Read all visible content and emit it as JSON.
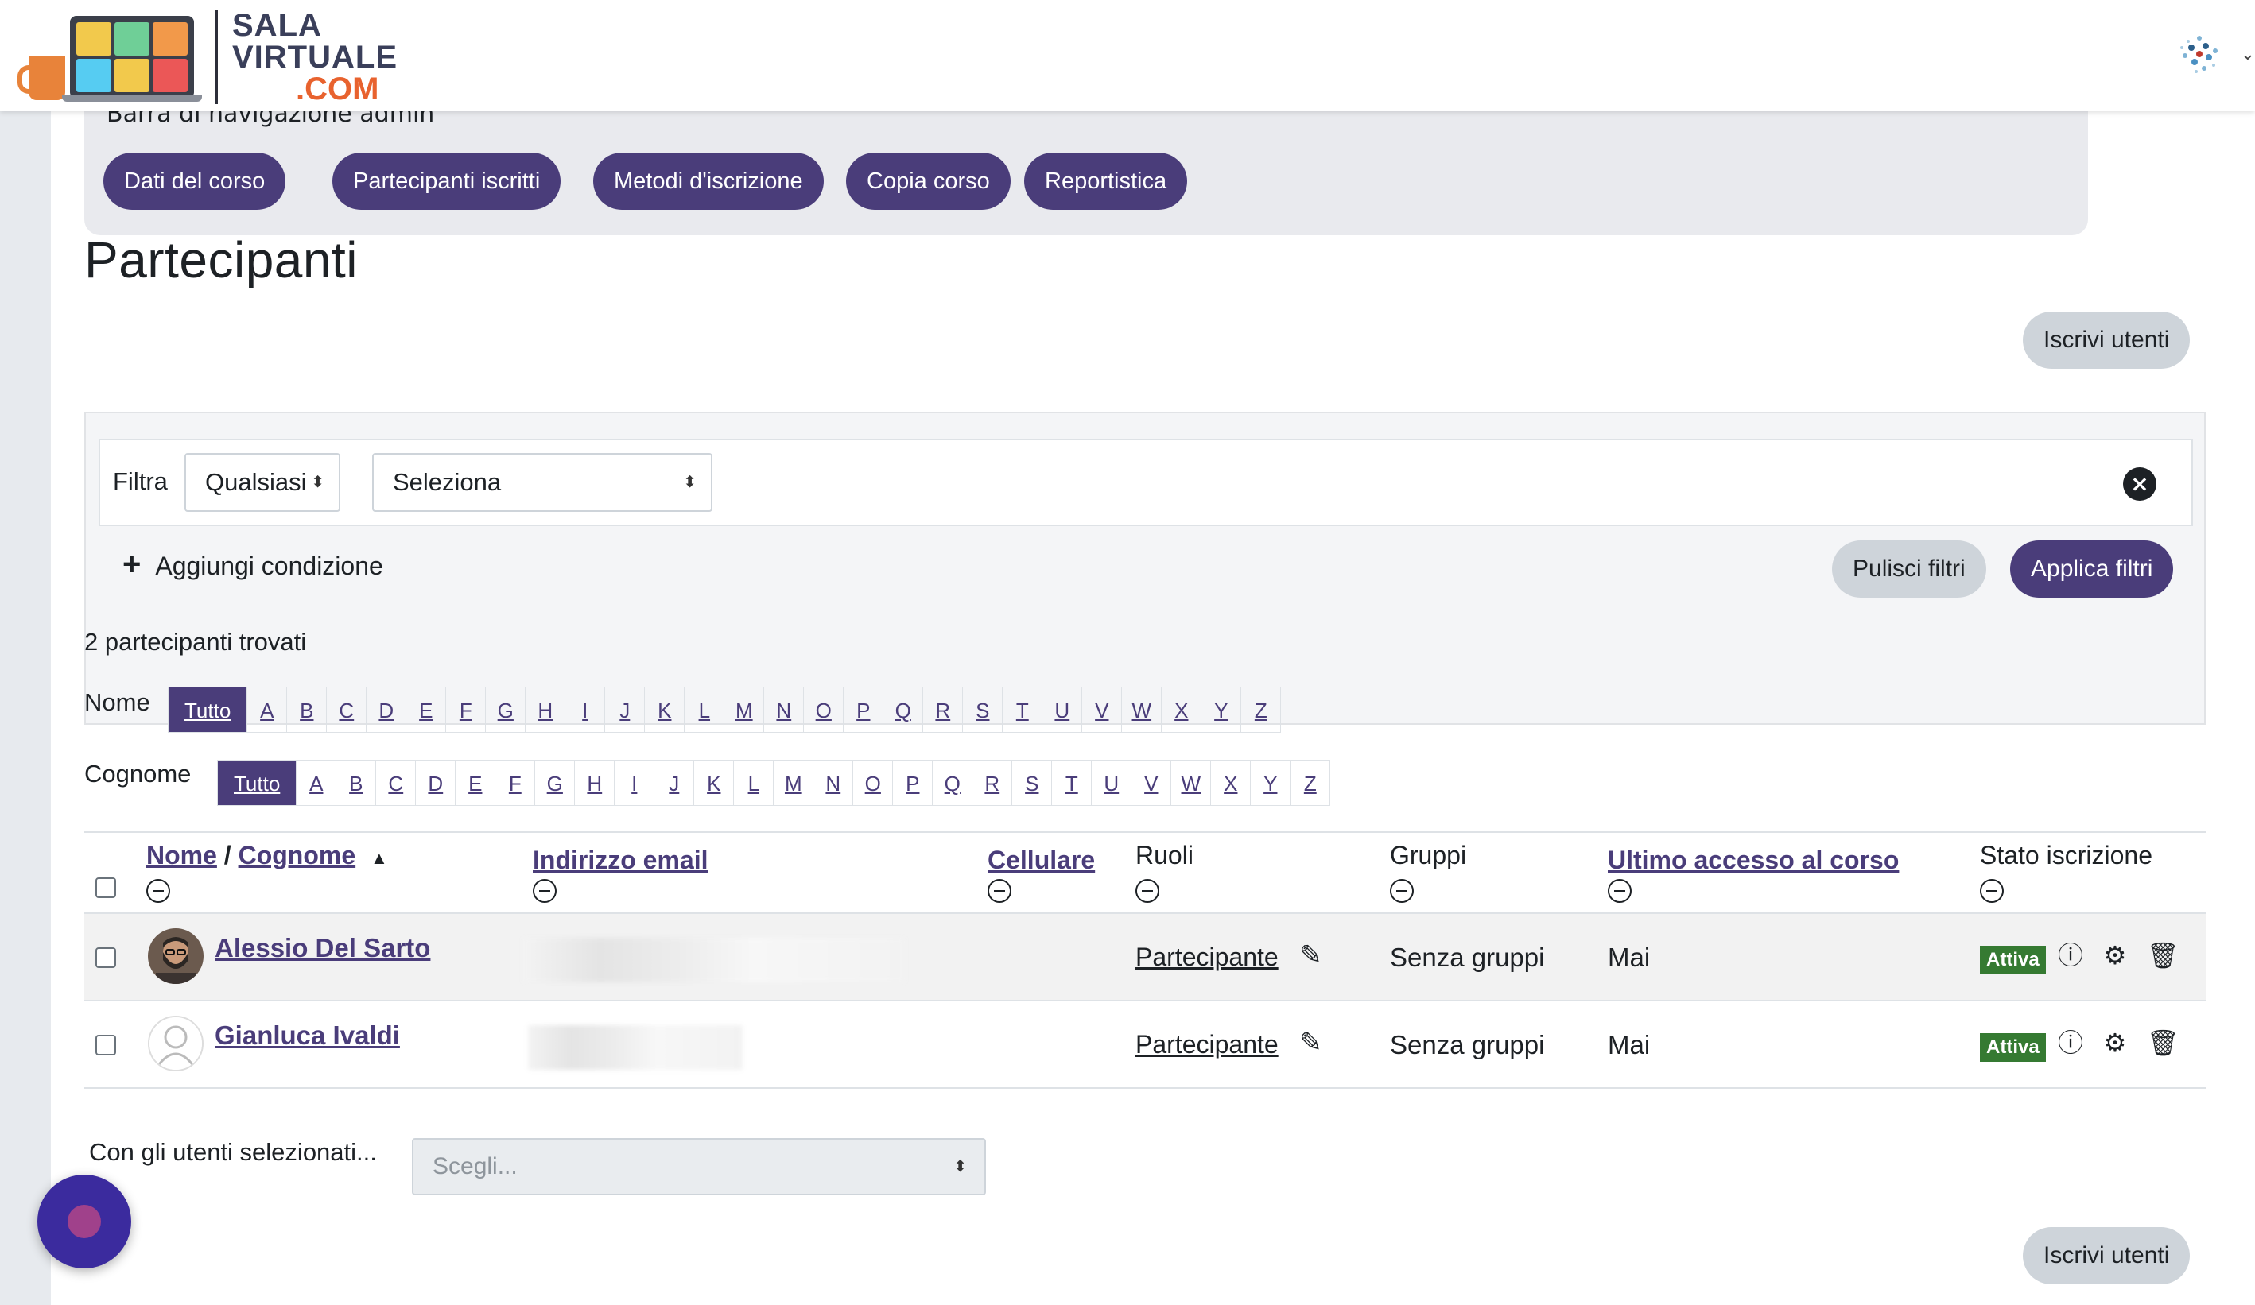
{
  "brand": {
    "line1": "SALA",
    "line2": "VIRTUALE",
    "line3": ".COM"
  },
  "secondary_nav": {
    "title": "Barra di navigazione admin",
    "items": [
      "Dati del corso",
      "Partecipanti iscritti",
      "Metodi d'iscrizione",
      "Copia corso",
      "Reportistica"
    ]
  },
  "page_title": "Partecipanti",
  "enrol_button": "Iscrivi utenti",
  "filter": {
    "label": "Filtra",
    "match": "Qualsiasi",
    "type": "Seleziona",
    "add_condition": "Aggiungi condizione",
    "clear": "Pulisci filtri",
    "apply": "Applica filtri"
  },
  "found_text": "2 partecipanti trovati",
  "initials": {
    "first_label": "Nome",
    "last_label": "Cognome",
    "all": "Tutto",
    "letters": [
      "A",
      "B",
      "C",
      "D",
      "E",
      "F",
      "G",
      "H",
      "I",
      "J",
      "K",
      "L",
      "M",
      "N",
      "O",
      "P",
      "Q",
      "R",
      "S",
      "T",
      "U",
      "V",
      "W",
      "X",
      "Y",
      "Z"
    ]
  },
  "table": {
    "headers": {
      "first_name": "Nome",
      "separator": "/",
      "last_name": "Cognome",
      "email": "Indirizzo email",
      "phone": "Cellulare",
      "roles": "Ruoli",
      "groups": "Gruppi",
      "last_access": "Ultimo accesso al corso",
      "status": "Stato iscrizione"
    },
    "rows": [
      {
        "name": "Alessio Del Sarto",
        "role": "Partecipante",
        "groups": "Senza gruppi",
        "last_access": "Mai",
        "status": "Attiva"
      },
      {
        "name": "Gianluca Ivaldi",
        "role": "Partecipante",
        "groups": "Senza gruppi",
        "last_access": "Mai",
        "status": "Attiva"
      }
    ]
  },
  "bulk": {
    "label": "Con gli utenti selezionati...",
    "placeholder": "Scegli..."
  },
  "colors": {
    "primary": "#4a3d7a",
    "status_green": "#357a32",
    "brand_orange": "#e8622e"
  }
}
